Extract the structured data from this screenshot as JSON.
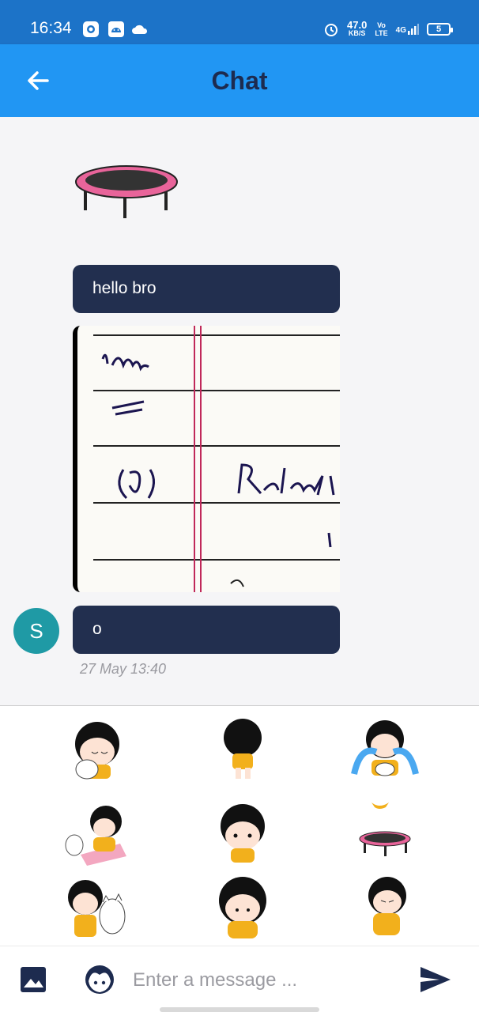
{
  "status_bar": {
    "time": "16:34",
    "speed_value": "47.0",
    "speed_unit": "KB/S",
    "volte_top": "Vo",
    "volte_bottom": "LTE",
    "network": "4G",
    "battery": "5"
  },
  "app_bar": {
    "title": "Chat",
    "back_icon": "arrow-left-icon"
  },
  "messages": [
    {
      "type": "sticker",
      "sticker": "trampoline"
    },
    {
      "type": "text",
      "text": "hello bro"
    },
    {
      "type": "image",
      "description_icon": "notebook-photo"
    },
    {
      "type": "text",
      "text": "o",
      "avatar_letter": "S",
      "timestamp": "27 May 13:40"
    }
  ],
  "sticker_panel": {
    "stickers": [
      "girl-hugging-cat-sticker",
      "girl-walking-sticker",
      "girl-crying-sticker",
      "girl-with-cat-on-mat-sticker",
      "girl-smiling-sticker",
      "trampoline-sticker",
      "girl-and-cat-sticker",
      "girl-hugging-knees-sticker",
      "girl-worried-sticker"
    ]
  },
  "input_bar": {
    "placeholder": "Enter a message ...",
    "image_icon": "image-icon",
    "emoji_icon": "sticker-face-icon",
    "send_icon": "send-icon"
  },
  "colors": {
    "status_bar": "#1c73c8",
    "app_bar": "#2196f3",
    "bubble": "#222f4f",
    "avatar": "#1f9aa5"
  }
}
